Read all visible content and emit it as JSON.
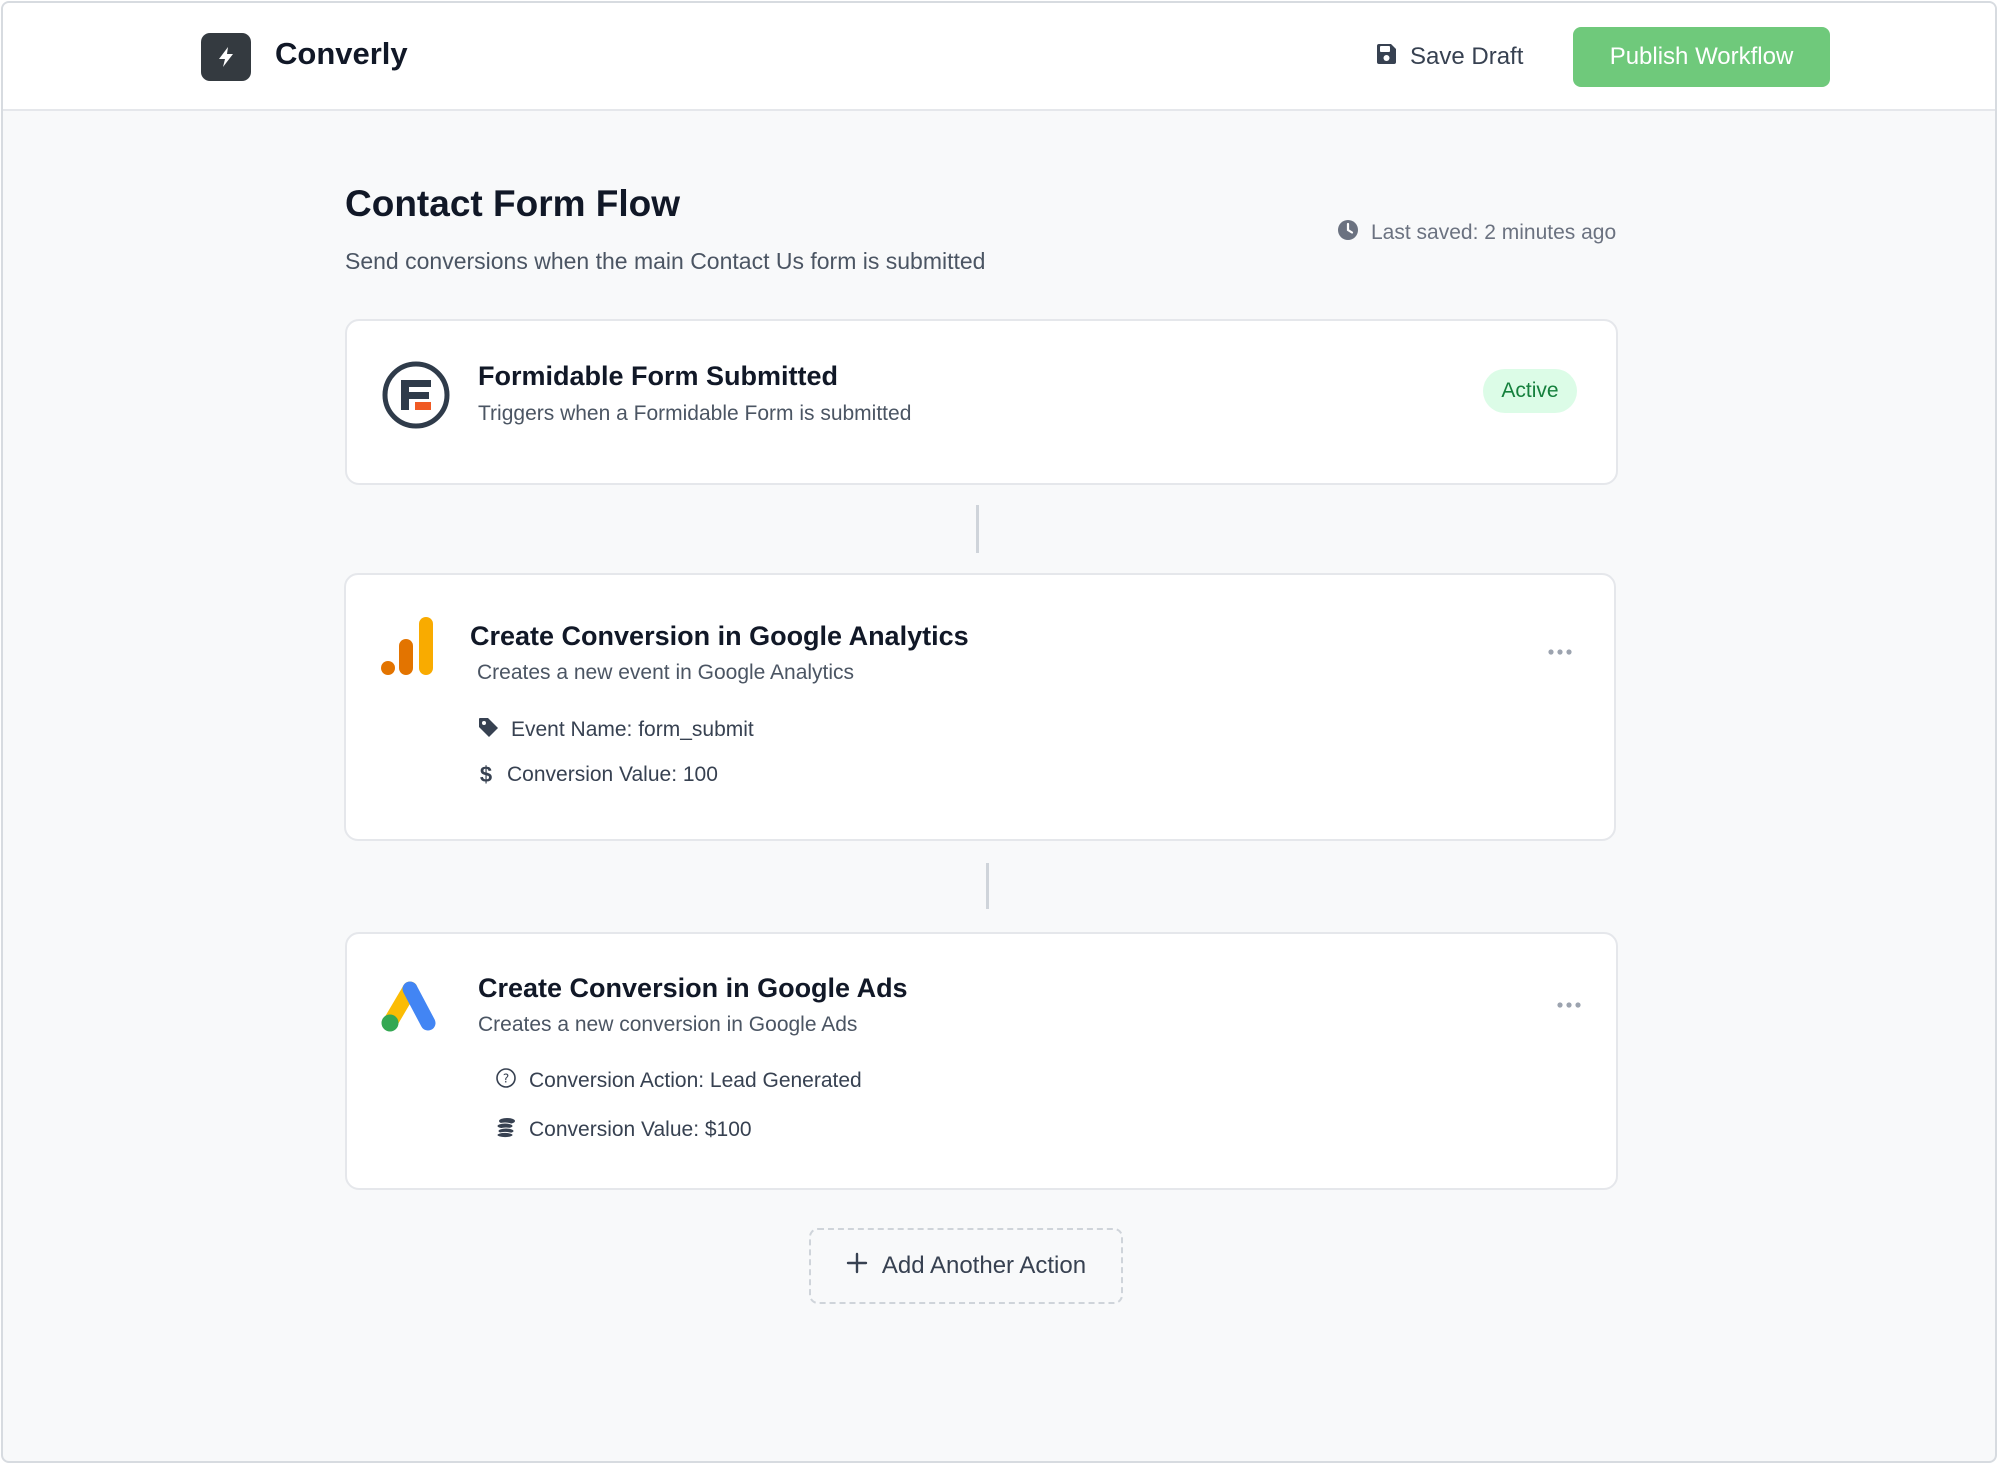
{
  "header": {
    "app_name": "Converly",
    "logo_icon": "lightning-bolt-icon",
    "save_draft_label": "Save Draft",
    "publish_label": "Publish Workflow",
    "publish_color": "#6fc97b"
  },
  "workflow": {
    "title": "Contact Form Flow",
    "subtitle": "Send conversions when the main Contact Us form is submitted",
    "last_saved": "Last saved: 2 minutes ago"
  },
  "trigger": {
    "title": "Formidable Form Submitted",
    "description": "Triggers when a Formidable Form is submitted",
    "status": "Active",
    "icon": "formidable-logo-icon"
  },
  "actions": [
    {
      "title": "Create Conversion in Google Analytics",
      "description": "Creates a new event in Google Analytics",
      "icon": "google-analytics-logo-icon",
      "details": [
        {
          "icon": "tag-icon",
          "text": "Event Name: form_submit"
        },
        {
          "icon": "dollar-icon",
          "text": "Conversion Value: 100"
        }
      ]
    },
    {
      "title": "Create Conversion in Google Ads",
      "description": "Creates a new conversion in Google Ads",
      "icon": "google-ads-logo-icon",
      "details": [
        {
          "icon": "question-circle-icon",
          "text": "Conversion Action: Lead Generated"
        },
        {
          "icon": "coins-icon",
          "text": "Conversion Value: $100"
        }
      ]
    }
  ],
  "add_action_label": "Add Another Action",
  "colors": {
    "active_badge_bg": "#dcfce7",
    "active_badge_text": "#15803d",
    "analytics_orange": "#e37400",
    "analytics_yellow": "#f9ab00",
    "ads_blue": "#4285f4",
    "ads_yellow": "#fbbc04",
    "ads_green": "#34a853"
  }
}
